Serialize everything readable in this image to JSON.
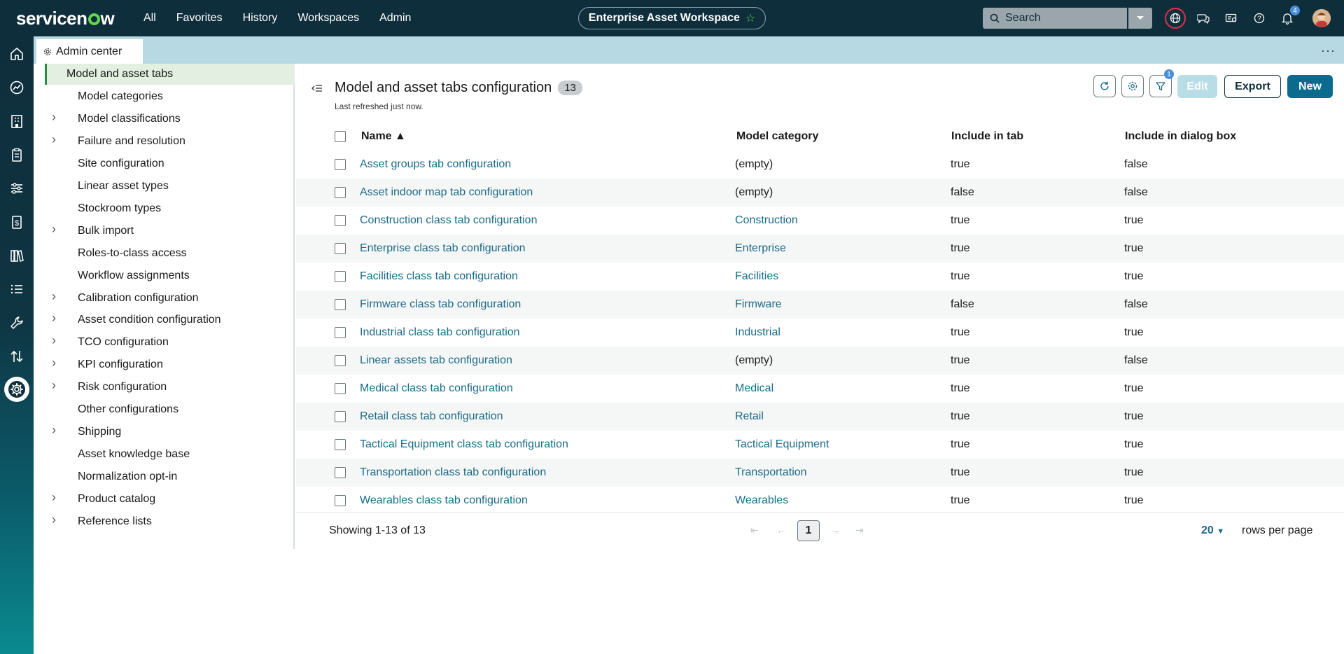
{
  "topbar": {
    "logo": "servicenow",
    "nav": [
      "All",
      "Favorites",
      "History",
      "Workspaces",
      "Admin"
    ],
    "workspace": "Enterprise Asset Workspace",
    "search_placeholder": "Search",
    "notification_count": "4",
    "icons": [
      "globe-icon",
      "chat-icon",
      "switcher-icon",
      "help-icon",
      "bell-icon"
    ]
  },
  "tab": {
    "label": "Admin center",
    "more": "···"
  },
  "sidenav": {
    "items": [
      {
        "label": "Model and asset tabs",
        "expandable": false,
        "active": true
      },
      {
        "label": "Model categories",
        "expandable": false
      },
      {
        "label": "Model classifications",
        "expandable": true
      },
      {
        "label": "Failure and resolution",
        "expandable": true
      },
      {
        "label": "Site configuration",
        "expandable": false
      },
      {
        "label": "Linear asset types",
        "expandable": false
      },
      {
        "label": "Stockroom types",
        "expandable": false
      },
      {
        "label": "Bulk import",
        "expandable": true
      },
      {
        "label": "Roles-to-class access",
        "expandable": false
      },
      {
        "label": "Workflow assignments",
        "expandable": false
      },
      {
        "label": "Calibration configuration",
        "expandable": true
      },
      {
        "label": "Asset condition configuration",
        "expandable": true
      },
      {
        "label": "TCO configuration",
        "expandable": true
      },
      {
        "label": "KPI configuration",
        "expandable": true
      },
      {
        "label": "Risk configuration",
        "expandable": true
      },
      {
        "label": "Other configurations",
        "expandable": false
      },
      {
        "label": "Shipping",
        "expandable": true
      },
      {
        "label": "Asset knowledge base",
        "expandable": false
      },
      {
        "label": "Normalization opt-in",
        "expandable": false
      },
      {
        "label": "Product catalog",
        "expandable": true
      },
      {
        "label": "Reference lists",
        "expandable": true
      }
    ]
  },
  "main": {
    "title": "Model and asset tabs configuration",
    "count": "13",
    "subtitle": "Last refreshed just now.",
    "filter_count": "1",
    "buttons": {
      "edit": "Edit",
      "export": "Export",
      "new": "New"
    },
    "columns": [
      "Name ▲",
      "Model category",
      "Include in tab",
      "Include in dialog box"
    ],
    "rows": [
      {
        "name": "Asset groups tab configuration",
        "category": "(empty)",
        "tab": "true",
        "dialog": "false"
      },
      {
        "name": "Asset indoor map tab configuration",
        "category": "(empty)",
        "tab": "false",
        "dialog": "false"
      },
      {
        "name": "Construction class tab configuration",
        "category": "Construction",
        "tab": "true",
        "dialog": "true"
      },
      {
        "name": "Enterprise class tab configuration",
        "category": "Enterprise",
        "tab": "true",
        "dialog": "true"
      },
      {
        "name": "Facilities class tab configuration",
        "category": "Facilities",
        "tab": "true",
        "dialog": "true"
      },
      {
        "name": "Firmware class tab configuration",
        "category": "Firmware",
        "tab": "false",
        "dialog": "false"
      },
      {
        "name": "Industrial class tab configuration",
        "category": "Industrial",
        "tab": "true",
        "dialog": "true"
      },
      {
        "name": "Linear assets tab configuration",
        "category": "(empty)",
        "tab": "true",
        "dialog": "false"
      },
      {
        "name": "Medical class tab configuration",
        "category": "Medical",
        "tab": "true",
        "dialog": "true"
      },
      {
        "name": "Retail class tab configuration",
        "category": "Retail",
        "tab": "true",
        "dialog": "true"
      },
      {
        "name": "Tactical Equipment class tab configuration",
        "category": "Tactical Equipment",
        "tab": "true",
        "dialog": "true"
      },
      {
        "name": "Transportation class tab configuration",
        "category": "Transportation",
        "tab": "true",
        "dialog": "true"
      },
      {
        "name": "Wearables class tab configuration",
        "category": "Wearables",
        "tab": "true",
        "dialog": "true"
      }
    ],
    "footer": {
      "showing": "Showing 1-13 of 13",
      "page": "1",
      "rows_per_page": "20",
      "rows_per_page_label": "rows per page"
    }
  },
  "colors": {
    "topbar": "#0f2e3b",
    "link": "#1b6b88",
    "accent_green": "#62d84e",
    "primary_button": "#0b6b8f"
  }
}
